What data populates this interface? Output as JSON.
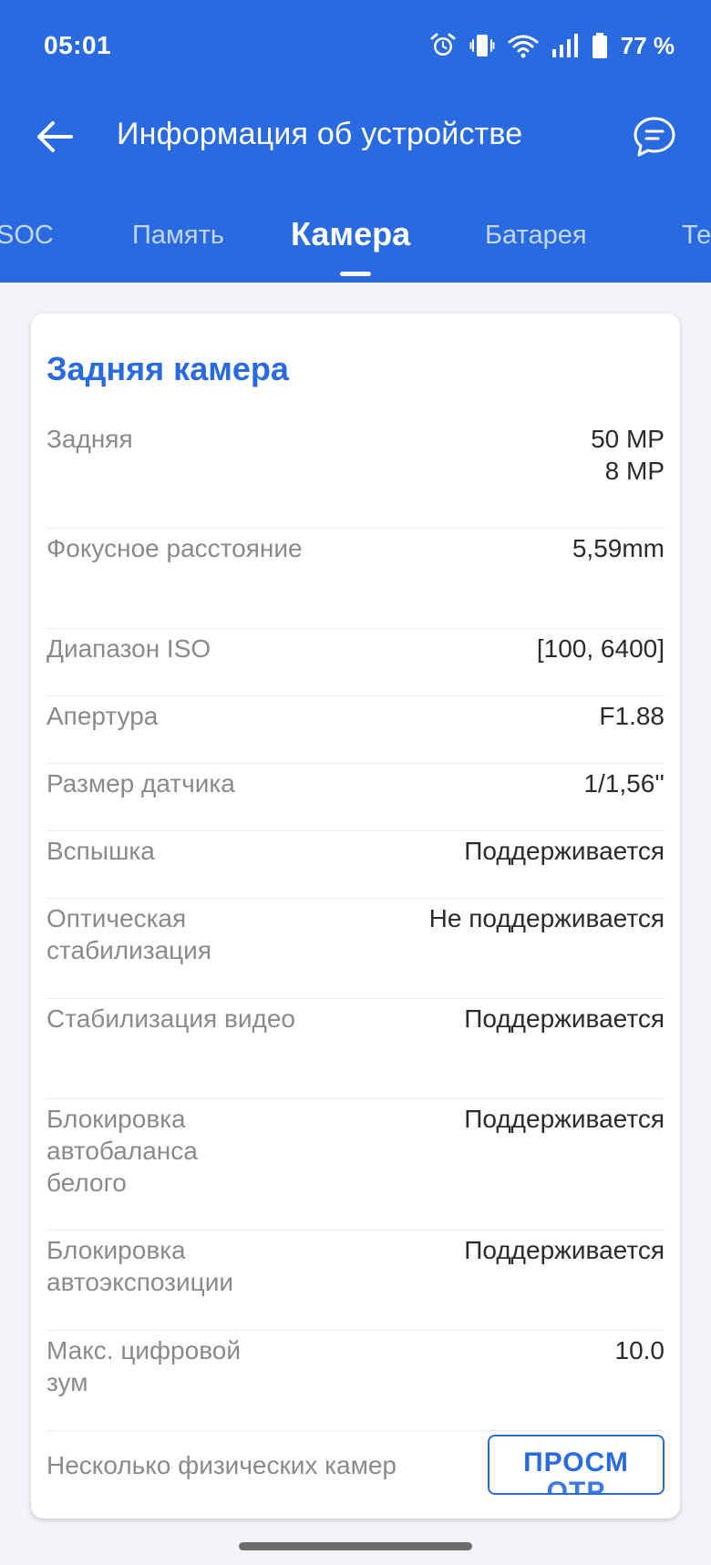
{
  "status_bar": {
    "time": "05:01",
    "battery_percent": "77 %",
    "icons": [
      "alarm-icon",
      "vibrate-icon",
      "wifi-icon",
      "signal-icon",
      "battery-icon"
    ]
  },
  "toolbar": {
    "title": "Информация об устройстве",
    "back_icon": "arrow-left-icon",
    "chat_icon": "chat-bubble-icon"
  },
  "tabs": [
    {
      "label": "SOC",
      "active": false
    },
    {
      "label": "Память",
      "active": false
    },
    {
      "label": "Камера",
      "active": true
    },
    {
      "label": "Батарея",
      "active": false
    },
    {
      "label": "Те",
      "active": false
    }
  ],
  "card": {
    "title": "Задняя камера",
    "rows": [
      {
        "label": "Задняя",
        "value_lines": [
          "50 MP",
          "8 MP"
        ]
      },
      {
        "label": "Фокусное расстояние",
        "value_lines": [
          "5,59mm"
        ]
      },
      {
        "label": "Диапазон ISO",
        "value_lines": [
          "[100, 6400]"
        ]
      },
      {
        "label": "Апертура",
        "value_lines": [
          "F1.88"
        ]
      },
      {
        "label": "Размер датчика",
        "value_lines": [
          "1/1,56''"
        ]
      },
      {
        "label": "Вспышка",
        "value_lines": [
          "Поддерживается"
        ]
      },
      {
        "label": "Оптическая стабилизация",
        "value_lines": [
          "Не поддерживается"
        ]
      },
      {
        "label": "Стабилизация видео",
        "value_lines": [
          "Поддерживается"
        ]
      },
      {
        "label": "Блокировка автобаланса белого",
        "value_lines": [
          "Поддерживается"
        ]
      },
      {
        "label": "Блокировка автоэкспозиции",
        "value_lines": [
          "Поддерживается"
        ]
      },
      {
        "label": "Макс. цифровой зум",
        "value_lines": [
          "10.0"
        ]
      }
    ],
    "multi_camera": {
      "label": "Несколько физических камер",
      "button_label": "ПРОСМ",
      "button_overflow": "ОТР"
    }
  },
  "colors": {
    "primary": "#2a6ae0",
    "label_text": "#8a8a8a",
    "value_text": "#2b2b2b"
  }
}
